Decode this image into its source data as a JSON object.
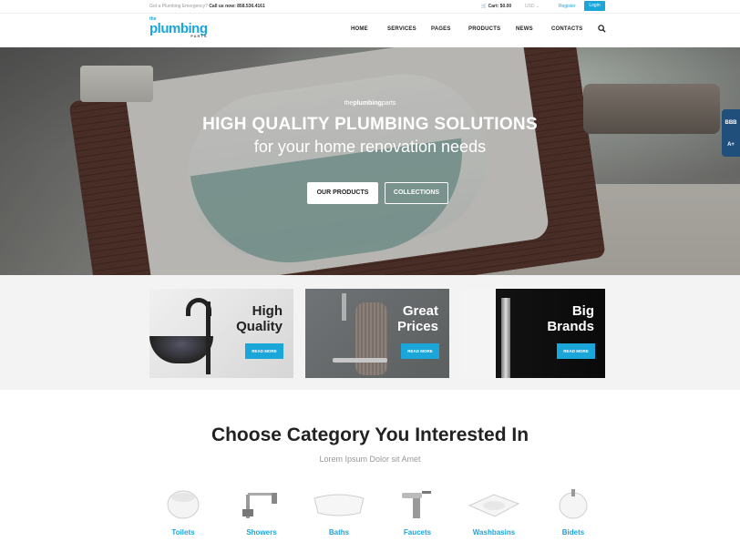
{
  "topbar": {
    "emergency_text": "Got a Plumbing Emergency?",
    "call_label": "Call us now: 858.536.4161",
    "cart": "Cart: $0.00",
    "currency": "USD",
    "register": "Register",
    "login": "Login"
  },
  "logo": {
    "the": "the",
    "main": "plumbing",
    "parts": "PARTS"
  },
  "nav": {
    "items": [
      "HOME",
      "SERVICES",
      "PAGES",
      "PRODUCTS",
      "NEWS",
      "CONTACTS"
    ]
  },
  "hero": {
    "brand_prefix": "the",
    "brand_bold": "plumbing",
    "brand_suffix": "parts",
    "title": "HIGH QUALITY PLUMBING SOLUTIONS",
    "subtitle": "for your home renovation needs",
    "primary_button": "OUR PRODUCTS",
    "secondary_button": "COLLECTIONS",
    "bbb_badge_line1": "BBB",
    "bbb_badge_line2": "A+"
  },
  "promo": {
    "cards": [
      {
        "title_line1": "High",
        "title_line2": "Quality",
        "button": "READ MORE"
      },
      {
        "title_line1": "Great",
        "title_line2": "Prices",
        "button": "READ MORE"
      },
      {
        "title_line1": "Big",
        "title_line2": "Brands",
        "button": "READ MORE"
      }
    ]
  },
  "categories": {
    "title": "Choose Category You Interested In",
    "subtitle": "Lorem Ipsum Dolor sit Amet",
    "items": [
      "Toilets",
      "Showers",
      "Baths",
      "Faucets",
      "Washbasins",
      "Bidets"
    ]
  },
  "colors": {
    "accent": "#1aa6d9",
    "text_dark": "#222222",
    "promo_bg": "#f3f3f3"
  }
}
